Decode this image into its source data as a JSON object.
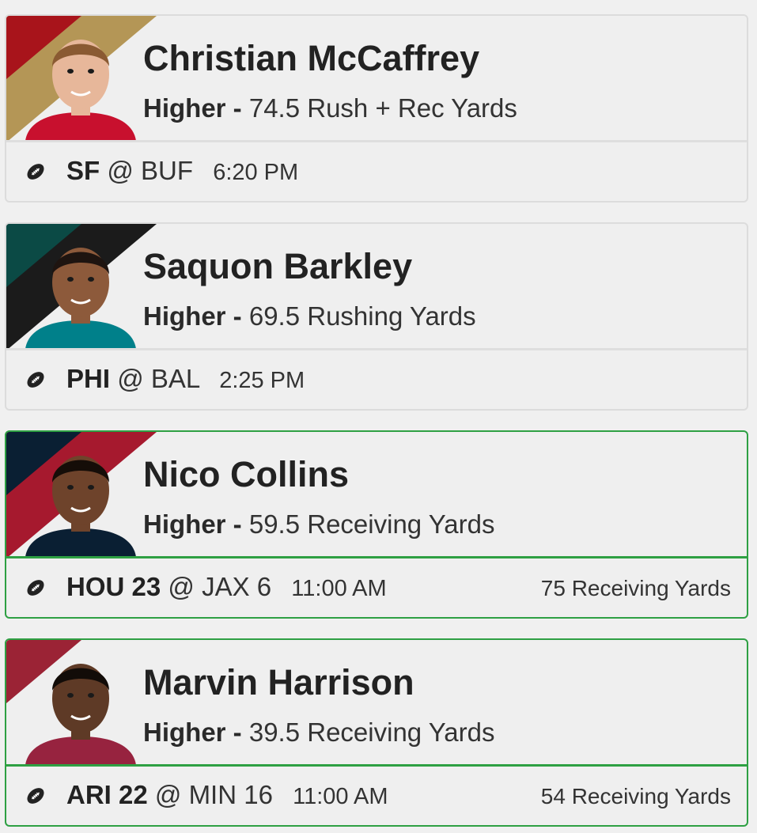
{
  "picks": [
    {
      "player": "Christian McCaffrey",
      "direction": "Higher -",
      "line": "74.5 Rush + Rec Yards",
      "away_team": "SF",
      "at": "@",
      "home_team": "BUF",
      "time": "6:20 PM",
      "result": "",
      "status": "pending",
      "colors": {
        "primary": "#a8141b",
        "secondary": "#b49656",
        "jersey": "#c8102e",
        "skin": "#e7b79a",
        "hair": "#8a5a32"
      }
    },
    {
      "player": "Saquon Barkley",
      "direction": "Higher -",
      "line": "69.5 Rushing Yards",
      "away_team": "PHI",
      "at": "@",
      "home_team": "BAL",
      "time": "2:25 PM",
      "result": "",
      "status": "pending",
      "colors": {
        "primary": "#0b4a45",
        "secondary": "#1b1b1b",
        "jersey": "#00808a",
        "skin": "#8d5a3b",
        "hair": "#1e1410"
      }
    },
    {
      "player": "Nico Collins",
      "direction": "Higher -",
      "line": "59.5 Receiving Yards",
      "away_team": "HOU 23",
      "at": "@",
      "home_team": "JAX 6",
      "time": "11:00 AM",
      "result": "75 Receiving Yards",
      "status": "won",
      "colors": {
        "primary": "#0a1f33",
        "secondary": "#a6192e",
        "jersey": "#0a1f33",
        "skin": "#6e432b",
        "hair": "#150d08"
      }
    },
    {
      "player": "Marvin Harrison",
      "direction": "Higher -",
      "line": "39.5 Receiving Yards",
      "away_team": "ARI 22",
      "at": "@",
      "home_team": "MIN 16",
      "time": "11:00 AM",
      "result": "54 Receiving Yards",
      "status": "won",
      "colors": {
        "primary": "#9b2335",
        "secondary": "#efefef",
        "jersey": "#97233f",
        "skin": "#5e3a26",
        "hair": "#120c08"
      }
    }
  ],
  "icons": {
    "sport": "football-icon"
  },
  "accent": {
    "won_border": "#2ea043",
    "neutral_border": "#dcdcdc"
  }
}
